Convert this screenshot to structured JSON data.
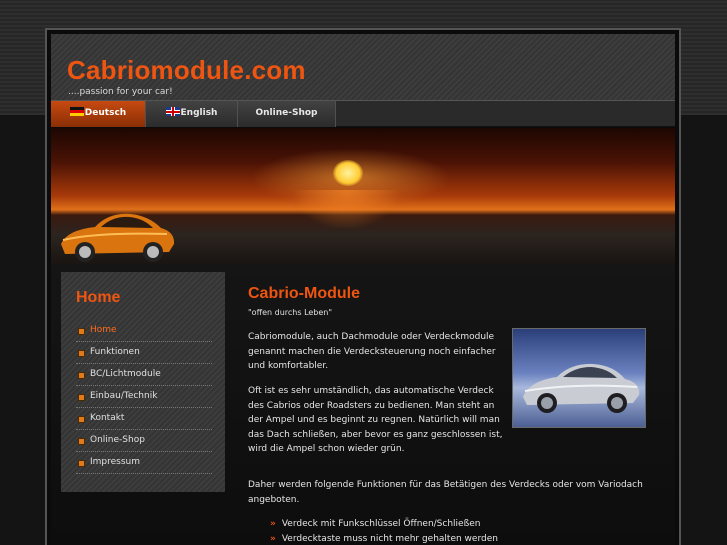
{
  "site": {
    "logo": "Cabriomodule.com",
    "tagline": "....passion for your car!"
  },
  "nav": [
    {
      "label": "Deutsch",
      "flag": "de-flag-icon",
      "active": true
    },
    {
      "label": "English",
      "flag": "gb-flag-icon",
      "active": false
    },
    {
      "label": "Online-Shop",
      "active": false
    }
  ],
  "sidebar": {
    "title": "Home",
    "items": [
      {
        "label": "Home",
        "active": true
      },
      {
        "label": "Funktionen"
      },
      {
        "label": "BC/Lichtmodule"
      },
      {
        "label": "Einbau/Technik"
      },
      {
        "label": "Kontakt"
      },
      {
        "label": "Online-Shop"
      },
      {
        "label": "Impressum"
      }
    ]
  },
  "main": {
    "title": "Cabrio-Module",
    "motto": "\"offen durchs Leben\"",
    "para1": "Cabriomodule, auch Dachmodule oder Verdeckmodule genannt machen die Verdecksteuerung noch einfacher und komfortabler.",
    "para2": "Oft ist es sehr umständlich, das automatische Verdeck des Cabrios oder Roadsters zu bedienen. Man steht an der Ampel und es beginnt zu regnen. Natürlich will man das Dach schließen, aber bevor es ganz geschlossen ist, wird die Ampel schon wieder grün.",
    "para3": "Daher werden folgende Funktionen für das Betätigen des Verdecks oder vom Variodach angeboten.",
    "features": [
      "Verdeck mit Funkschlüssel Öffnen/Schließen",
      "Verdecktaste muss nicht mehr gehalten werden"
    ]
  },
  "colors": {
    "accent": "#ee5511",
    "background": "#0b0b0b"
  }
}
